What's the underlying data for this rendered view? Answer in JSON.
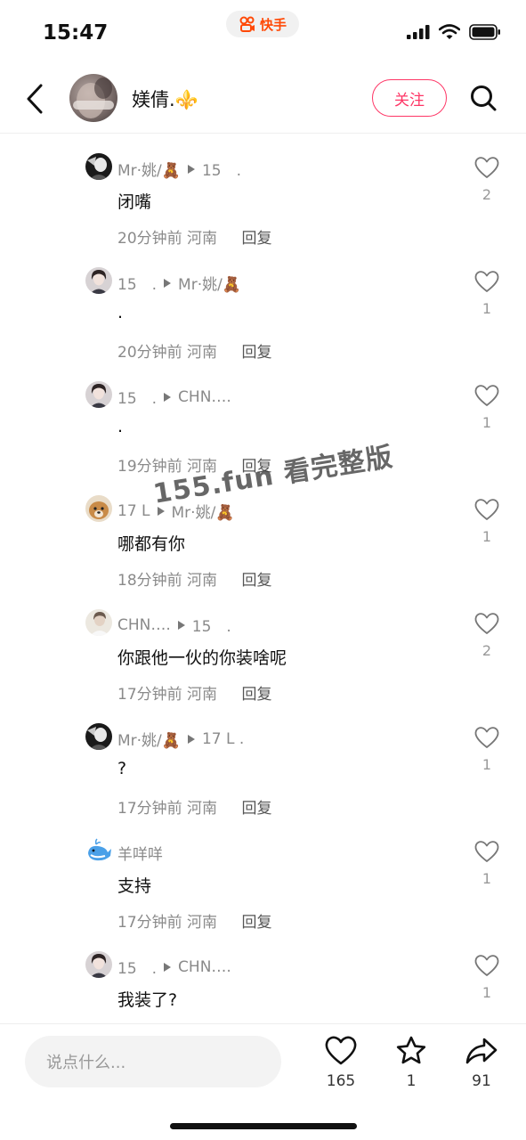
{
  "status": {
    "time": "15:47",
    "app_name": "快手"
  },
  "header": {
    "title": "媄倩.⚜️",
    "follow_label": "关注"
  },
  "comments": [
    {
      "from": "Mr·姚/🧸",
      "to": "15　.",
      "text": "闭嘴",
      "time": "20分钟前",
      "location": "河南",
      "reply": "回复",
      "likes": "2",
      "avatar": "bw-dark"
    },
    {
      "from": "15　.",
      "to": "Mr·姚/🧸",
      "text": ".",
      "time": "20分钟前",
      "location": "河南",
      "reply": "回复",
      "likes": "1",
      "avatar": "girl"
    },
    {
      "from": "15　.",
      "to": "CHN….",
      "text": ".",
      "time": "19分钟前",
      "location": "河南",
      "reply": "回复",
      "likes": "1",
      "avatar": "girl"
    },
    {
      "from": "17 L",
      "to": "Mr·姚/🧸",
      "text": "哪都有你",
      "time": "18分钟前",
      "location": "河南",
      "reply": "回复",
      "likes": "1",
      "avatar": "dog"
    },
    {
      "from": "CHN….",
      "to": "15　.",
      "text": "你跟他一伙的你装啥呢",
      "time": "17分钟前",
      "location": "河南",
      "reply": "回复",
      "likes": "2",
      "avatar": "light"
    },
    {
      "from": "Mr·姚/🧸",
      "to": "17 L .",
      "text": "?",
      "time": "17分钟前",
      "location": "河南",
      "reply": "回复",
      "likes": "1",
      "avatar": "bw-dark"
    },
    {
      "from": "羊咩咩",
      "to": "",
      "text": "支持",
      "time": "17分钟前",
      "location": "河南",
      "reply": "回复",
      "likes": "1",
      "avatar": "whale"
    },
    {
      "from": "15　.",
      "to": "CHN….",
      "text": "我装了?",
      "time": "",
      "location": "",
      "reply": "",
      "likes": "1",
      "avatar": "girl"
    }
  ],
  "watermark": "155.fun 看完整版",
  "bottom": {
    "input_placeholder": "说点什么...",
    "like_count": "165",
    "star_count": "1",
    "share_count": "91"
  },
  "icons": {
    "back": "chevron-left-icon",
    "search": "search-icon",
    "like": "heart-icon",
    "collect": "star-icon",
    "share": "share-arrow-icon"
  },
  "colors": {
    "accent": "#fe3666",
    "brand": "#ff4906"
  }
}
